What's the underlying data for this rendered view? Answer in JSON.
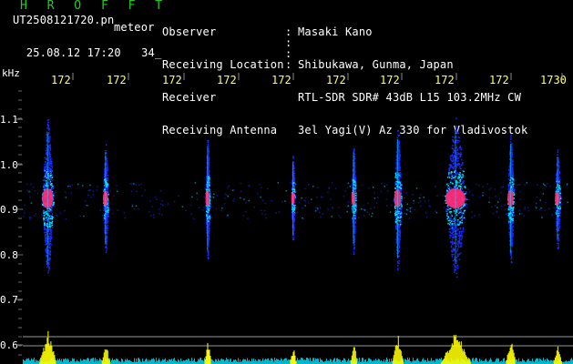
{
  "header": {
    "brand": "H R O F F T",
    "filename": "UT2508121720.pn",
    "meteor_label": "meteor",
    "datetime": "25.08.12 17:20",
    "count": "34",
    "fields": [
      {
        "label": "Observer",
        "value": "Masaki Kano"
      },
      {
        "label": "Receiving Location",
        "value": "Shibukawa, Gunma, Japan"
      },
      {
        "label": "Receiver",
        "value": "RTL-SDR SDR# 43dB L15 103.2MHz CW"
      },
      {
        "label": "Receiving Antenna",
        "value": "3el Yagi(V) Az 330 for Vladivostok"
      }
    ]
  },
  "axis": {
    "unit": "kHz",
    "y_ticks": [
      "1.1",
      "1.0",
      "0.9",
      "0.8",
      "0.7",
      "0.6"
    ],
    "time_ticks": [
      "172",
      "172",
      "172",
      "172",
      "172",
      "172",
      "172",
      "172",
      "172",
      "1730"
    ]
  },
  "colors": {
    "brand": "#22cc22",
    "time_tick": "#ffff66",
    "blue": "#1a2aff",
    "cyan": "#00e5ff",
    "magenta": "#ff2a7a",
    "yellow": "#ffff00"
  },
  "events": [
    {
      "t": 0.05,
      "strength": 1.0,
      "width": 0.022
    },
    {
      "t": 0.155,
      "strength": 0.55,
      "width": 0.01
    },
    {
      "t": 0.34,
      "strength": 0.7,
      "width": 0.008
    },
    {
      "t": 0.495,
      "strength": 0.35,
      "width": 0.006
    },
    {
      "t": 0.605,
      "strength": 0.55,
      "width": 0.008
    },
    {
      "t": 0.685,
      "strength": 0.85,
      "width": 0.014
    },
    {
      "t": 0.79,
      "strength": 1.0,
      "width": 0.04
    },
    {
      "t": 0.89,
      "strength": 0.75,
      "width": 0.012
    },
    {
      "t": 0.975,
      "strength": 0.45,
      "width": 0.01
    }
  ]
}
